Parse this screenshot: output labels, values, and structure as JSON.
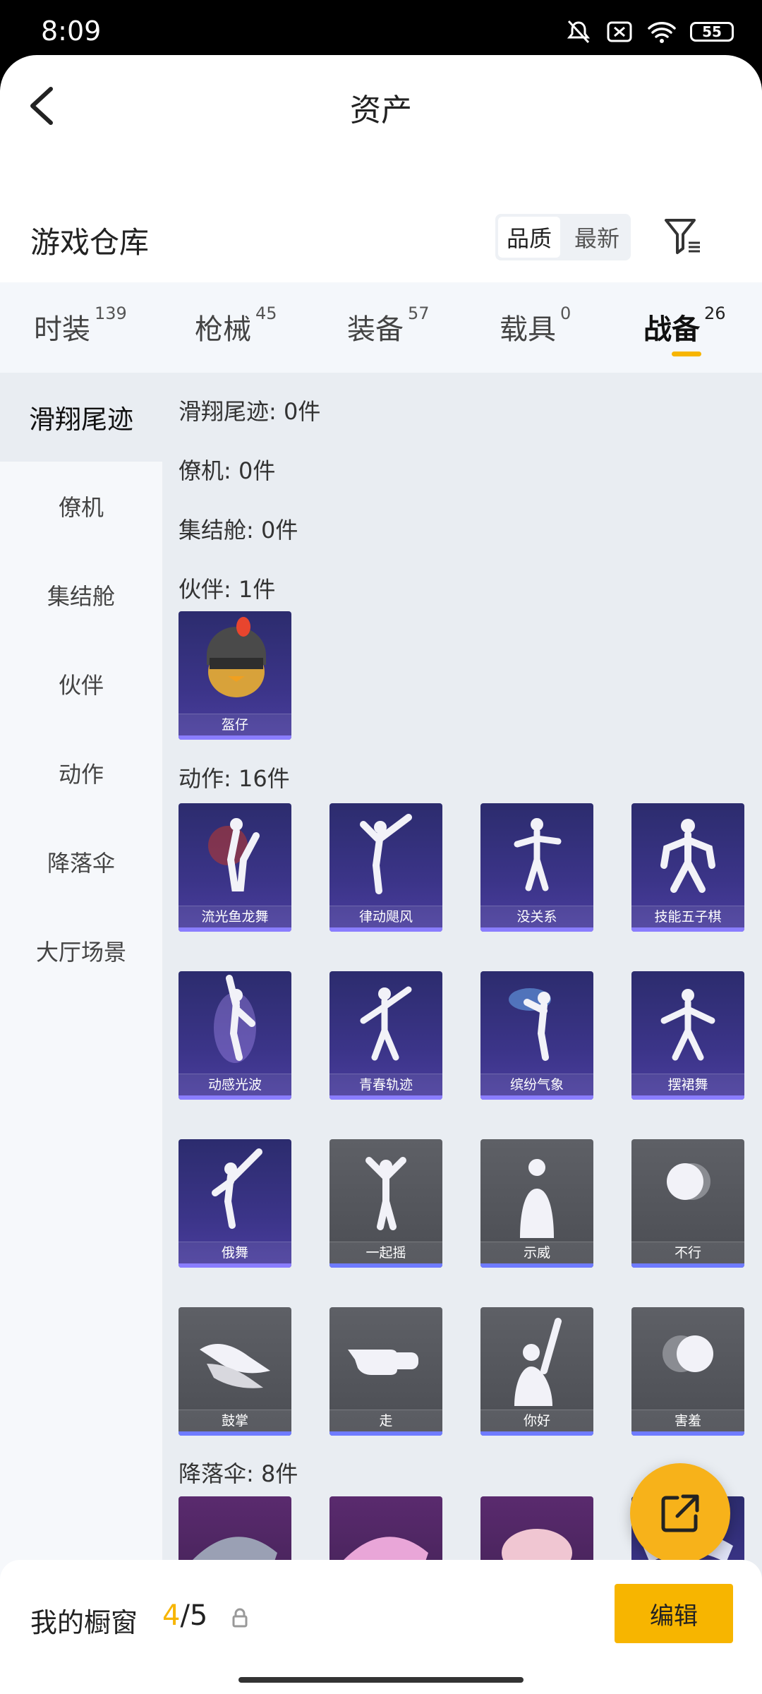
{
  "status": {
    "time": "8:09",
    "battery": "55"
  },
  "header": {
    "title": "资产"
  },
  "section": {
    "title": "游戏仓库",
    "sort_options": [
      "品质",
      "最新"
    ],
    "active_sort": "品质"
  },
  "tabs": [
    {
      "label": "时装",
      "count": "139"
    },
    {
      "label": "枪械",
      "count": "45"
    },
    {
      "label": "装备",
      "count": "57"
    },
    {
      "label": "载具",
      "count": "0"
    },
    {
      "label": "战备",
      "count": "26"
    }
  ],
  "active_tab": "战备",
  "sidebar": {
    "items": [
      {
        "label": "滑翔尾迹"
      },
      {
        "label": "僚机"
      },
      {
        "label": "集结舱"
      },
      {
        "label": "伙伴"
      },
      {
        "label": "动作"
      },
      {
        "label": "降落伞"
      },
      {
        "label": "大厅场景"
      }
    ],
    "active": "滑翔尾迹"
  },
  "content": {
    "categories": [
      {
        "title": "滑翔尾迹: 0件"
      },
      {
        "title": "僚机: 0件"
      },
      {
        "title": "集结舱: 0件"
      },
      {
        "title": "伙伴: 1件"
      },
      {
        "title": "动作: 16件"
      },
      {
        "title": "降落伞: 8件"
      }
    ],
    "companion_items": [
      {
        "name": "盔仔"
      }
    ],
    "action_items": [
      {
        "name": "流光鱼龙舞"
      },
      {
        "name": "律动飓风"
      },
      {
        "name": "没关系"
      },
      {
        "name": "技能五子棋"
      },
      {
        "name": "动感光波"
      },
      {
        "name": "青春轨迹"
      },
      {
        "name": "缤纷气象"
      },
      {
        "name": "摆裙舞"
      },
      {
        "name": "俄舞"
      },
      {
        "name": "一起摇"
      },
      {
        "name": "示威"
      },
      {
        "name": "不行"
      },
      {
        "name": "鼓掌"
      },
      {
        "name": "走"
      },
      {
        "name": "你好"
      },
      {
        "name": "害羞"
      }
    ]
  },
  "bottom": {
    "label": "我的橱窗",
    "current": "4",
    "total": "/5",
    "edit_label": "编辑"
  },
  "colors": {
    "accent": "#f7b500",
    "card_purple": "#3b3488",
    "card_grey": "#55575d"
  }
}
